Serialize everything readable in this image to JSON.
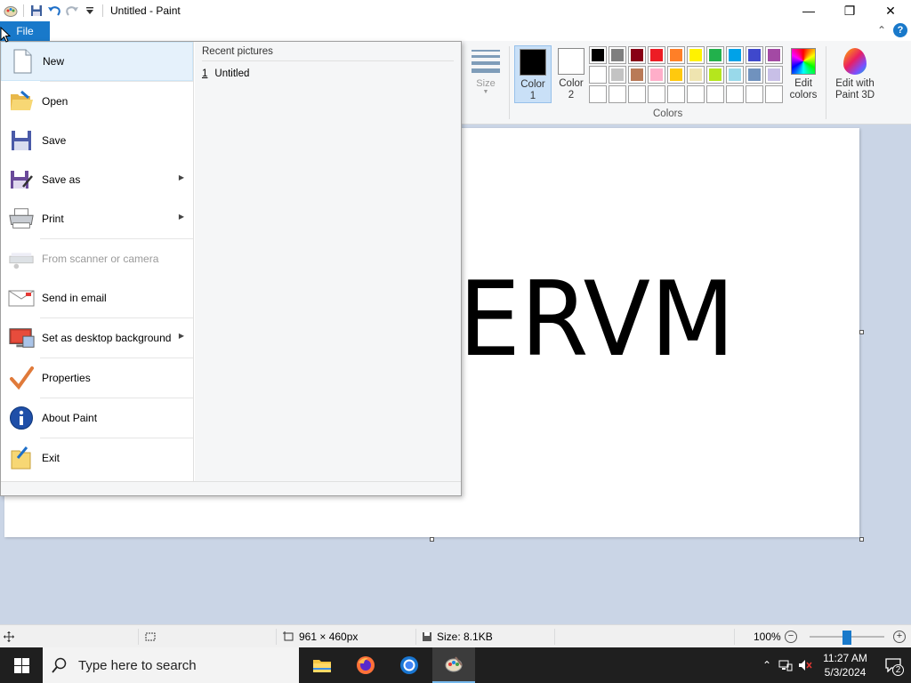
{
  "window": {
    "title": "Untitled - Paint",
    "controls": {
      "minimize": "—",
      "maximize": "❐",
      "close": "✕"
    }
  },
  "ribbon": {
    "file_tab": "File",
    "size_label": "Size",
    "color1_label": "Color 1",
    "color2_label": "Color 2",
    "color1_value": "#000000",
    "color2_value": "#ffffff",
    "colors_group_label": "Colors",
    "edit_colors_label": "Edit colors",
    "paint3d_label": "Edit with Paint 3D",
    "palette": [
      "#000000",
      "#7f7f7f",
      "#880015",
      "#ed1c24",
      "#ff7f27",
      "#fff200",
      "#22b14c",
      "#00a2e8",
      "#3f48cc",
      "#a349a4",
      "#ffffff",
      "#c3c3c3",
      "#b97a57",
      "#ffaec9",
      "#ffc90e",
      "#efe4b0",
      "#b5e61d",
      "#99d9ea",
      "#7092be",
      "#c8bfe7",
      "",
      "",
      "",
      "",
      "",
      "",
      "",
      "",
      "",
      ""
    ]
  },
  "canvas": {
    "text": "GERVM"
  },
  "file_menu": {
    "items": [
      {
        "label": "New",
        "icon": "new-document-icon"
      },
      {
        "label": "Open",
        "icon": "open-folder-icon"
      },
      {
        "label": "Save",
        "icon": "save-disk-icon"
      },
      {
        "label": "Save as",
        "icon": "save-as-icon",
        "submenu": true
      },
      {
        "label": "Print",
        "icon": "printer-icon",
        "submenu": true
      },
      {
        "label": "From scanner or camera",
        "icon": "scanner-icon",
        "disabled": true
      },
      {
        "label": "Send in email",
        "icon": "email-icon"
      },
      {
        "label": "Set as desktop background",
        "icon": "desktop-icon",
        "submenu": true
      },
      {
        "label": "Properties",
        "icon": "checkmark-icon"
      },
      {
        "label": "About Paint",
        "icon": "info-icon"
      },
      {
        "label": "Exit",
        "icon": "exit-icon"
      }
    ],
    "recent_header": "Recent pictures",
    "recent": [
      {
        "num": "1",
        "name": "Untitled"
      }
    ]
  },
  "statusbar": {
    "dimensions": "961 × 460px",
    "size": "Size: 8.1KB",
    "zoom": "100%",
    "zoom_level": 0.5
  },
  "taskbar": {
    "search_placeholder": "Type here to search",
    "time": "11:27 AM",
    "date": "5/3/2024",
    "notifications": "2"
  }
}
